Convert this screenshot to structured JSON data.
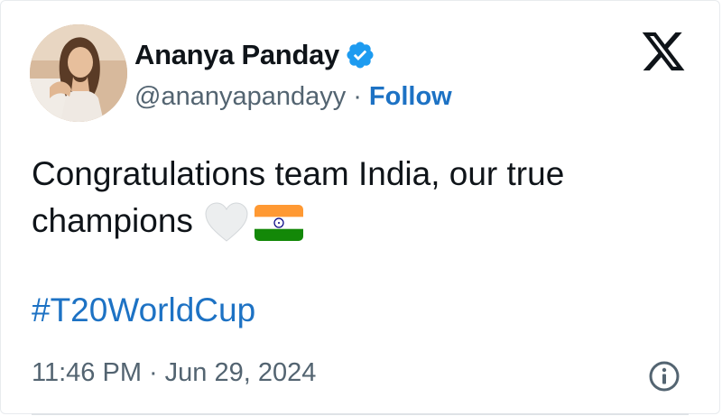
{
  "author": {
    "display_name": "Ananya Panday",
    "handle": "@ananyapandayy",
    "separator": "·",
    "follow_label": "Follow",
    "verified_icon": "verified-badge-icon"
  },
  "header": {
    "logo_icon": "x-logo-icon"
  },
  "tweet": {
    "text_line1": "Congratulations team India, our true",
    "text_line2": "champions",
    "emojis": [
      "white-heart-icon",
      "india-flag-icon"
    ],
    "hashtag": "#T20WorldCup"
  },
  "meta": {
    "time": "11:46 PM",
    "separator": "·",
    "date": "Jun 29, 2024",
    "info_icon": "info-icon"
  },
  "colors": {
    "link": "#1d72c4",
    "verified": "#1d9bf0",
    "text": "#0f1419",
    "secondary": "#536471",
    "saffron": "#ff9933",
    "india_green": "#138808",
    "chakra": "#000080"
  }
}
